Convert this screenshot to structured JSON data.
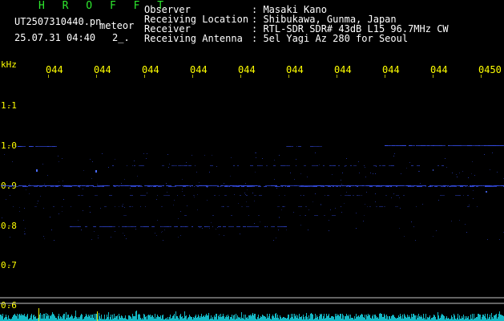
{
  "header": {
    "app_name": "H R O F F T",
    "file_name": "UT2507310440.pn",
    "mode": "meteor",
    "datetime": "25.07.31 04:40",
    "span": "2_."
  },
  "station": [
    {
      "label": "Observer",
      "value": ": Masaki Kano"
    },
    {
      "label": "Receiving Location",
      "value": ": Shibukawa, Gunma, Japan"
    },
    {
      "label": "Receiver",
      "value": ": RTL-SDR SDR# 43dB L15 96.7MHz CW"
    },
    {
      "label": "Receiving Antenna",
      "value": ": 5el Yagi Az 280 for Seoul"
    }
  ],
  "y_axis": {
    "unit": "kHz",
    "ticks": [
      "1.1",
      "1.0",
      "0.9",
      "0.8",
      "0.7",
      "0.6"
    ]
  },
  "time_axis": {
    "ticks": [
      "044",
      "044",
      "044",
      "044",
      "044",
      "044",
      "044",
      "044",
      "044",
      "0450"
    ]
  },
  "colors": {
    "background": "#000000",
    "title": "#2ee82e",
    "text": "#ffffff",
    "axis_labels": "#ffff00",
    "signal": "#3a55ff",
    "noise_floor": "#18d8e8"
  }
}
